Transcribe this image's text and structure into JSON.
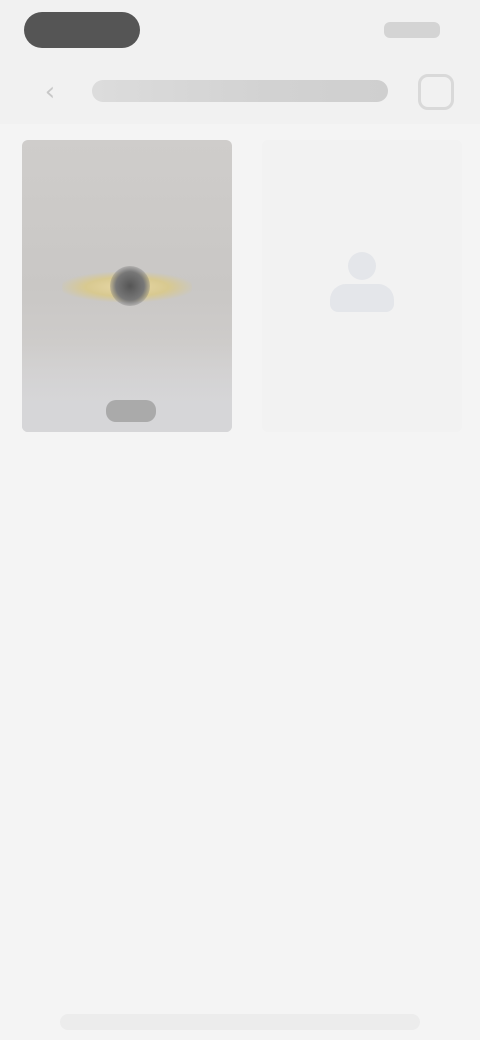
{
  "icons": {
    "back": "chevron-left-icon",
    "action": "square-icon",
    "add_person": "person-add-icon"
  },
  "header": {
    "back_glyph": "‹"
  },
  "colors": {
    "background": "#f4f4f4",
    "accent_warm": "#e8d8a8",
    "pill": "#3a3a3a"
  }
}
